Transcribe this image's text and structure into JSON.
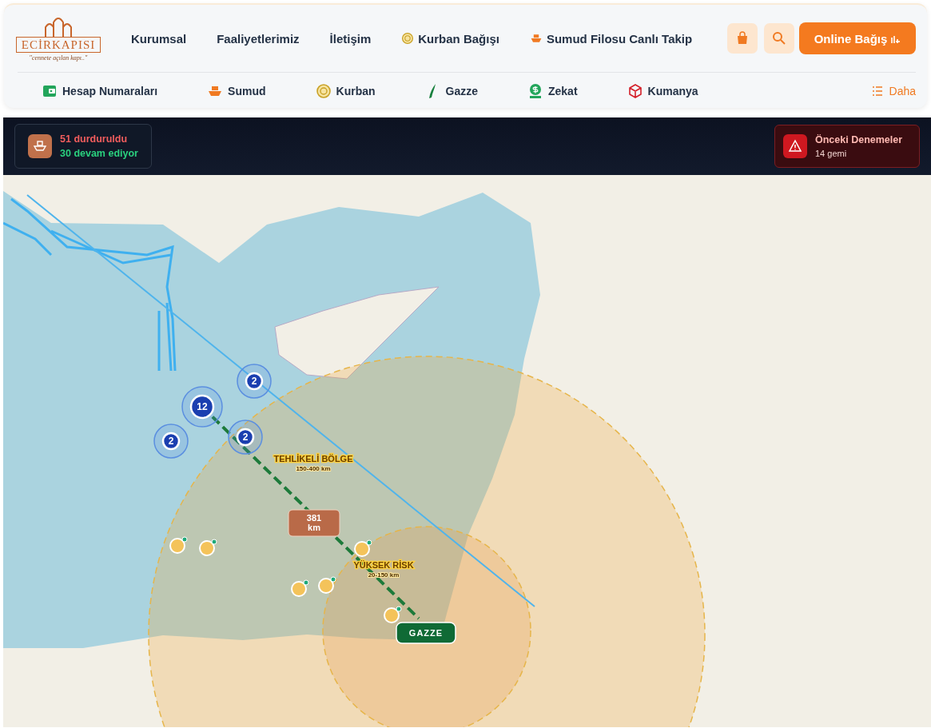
{
  "logo": {
    "name": "ECİRKAPISI",
    "tagline": "\"cennete açılan kapı..\""
  },
  "nav": [
    {
      "label": "Kurumsal"
    },
    {
      "label": "Faaliyetlerimiz"
    },
    {
      "label": "İletişim"
    },
    {
      "label": "Kurban Bağışı"
    },
    {
      "label": "Sumud Filosu Canlı Takip"
    }
  ],
  "donate": {
    "label": "Online Bağış"
  },
  "quick_links": [
    {
      "label": "Hesap Numaraları"
    },
    {
      "label": "Sumud"
    },
    {
      "label": "Kurban"
    },
    {
      "label": "Gazze"
    },
    {
      "label": "Zekat"
    },
    {
      "label": "Kumanya"
    }
  ],
  "more": {
    "label": "Daha"
  },
  "status": {
    "stopped": "51 durduruldu",
    "continuing": "30 devam ediyor"
  },
  "previous": {
    "title": "Önceki Denemeler",
    "count": "14 gemi"
  },
  "map": {
    "zones": [
      {
        "title": "TEHLİKELİ BÖLGE",
        "range": "150-400 km"
      },
      {
        "title": "YÜKSEK RİSK",
        "range": "20-150 km"
      }
    ],
    "distance": "381 km",
    "destination": "GAZZE",
    "clusters": [
      {
        "count": "12"
      },
      {
        "count": "2"
      },
      {
        "count": "2"
      },
      {
        "count": "2"
      }
    ]
  }
}
